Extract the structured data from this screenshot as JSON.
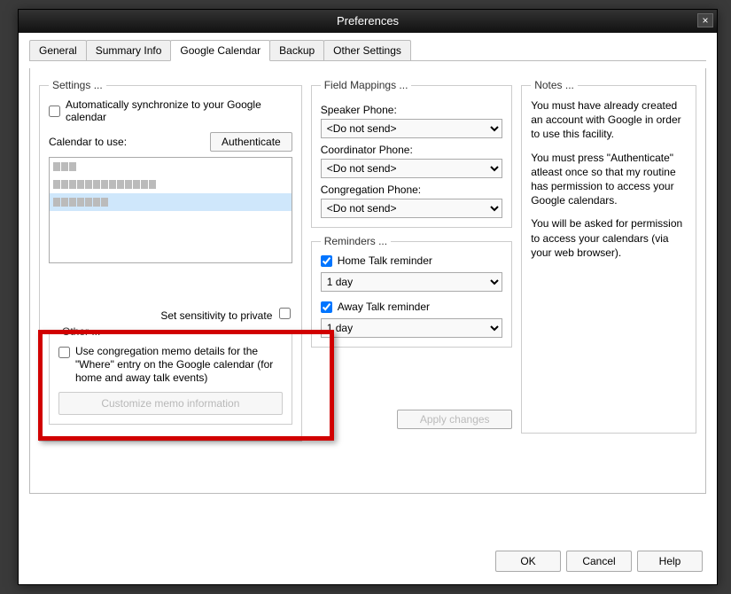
{
  "window": {
    "title": "Preferences"
  },
  "tabs": {
    "items": [
      "General",
      "Summary Info",
      "Google Calendar",
      "Backup",
      "Other Settings"
    ],
    "active": 2
  },
  "settings": {
    "legend": "Settings ...",
    "autosync_label": "Automatically synchronize to your Google calendar",
    "autosync_checked": false,
    "calendar_label": "Calendar to use:",
    "authenticate_btn": "Authenticate",
    "calendar_rows": 3,
    "privacy_label": "Set sensitivity to private",
    "privacy_checked": false
  },
  "other": {
    "legend": "Other ...",
    "memo_label": "Use congregation memo details for the \"Where\" entry on the Google calendar (for home and away talk events)",
    "memo_checked": false,
    "customize_btn": "Customize memo information"
  },
  "field_mappings": {
    "legend": "Field Mappings ...",
    "speaker_label": "Speaker Phone:",
    "speaker_value": "<Do not send>",
    "coordinator_label": "Coordinator Phone:",
    "coordinator_value": "<Do not send>",
    "congregation_label": "Congregation Phone:",
    "congregation_value": "<Do not send>"
  },
  "reminders": {
    "legend": "Reminders ...",
    "home_label": "Home Talk reminder",
    "home_checked": true,
    "home_value": "1 day",
    "away_label": "Away Talk reminder",
    "away_checked": true,
    "away_value": "1 day"
  },
  "apply_btn": "Apply changes",
  "notes": {
    "legend": "Notes ...",
    "p1": "You must have already created an account with Google in order to use this facility.",
    "p2": "You must press \"Authenticate\" atleast once so that my routine has permission to access your Google calendars.",
    "p3": "You will be asked for permission to access your calendars (via your web browser)."
  },
  "footer": {
    "ok": "OK",
    "cancel": "Cancel",
    "help": "Help"
  }
}
